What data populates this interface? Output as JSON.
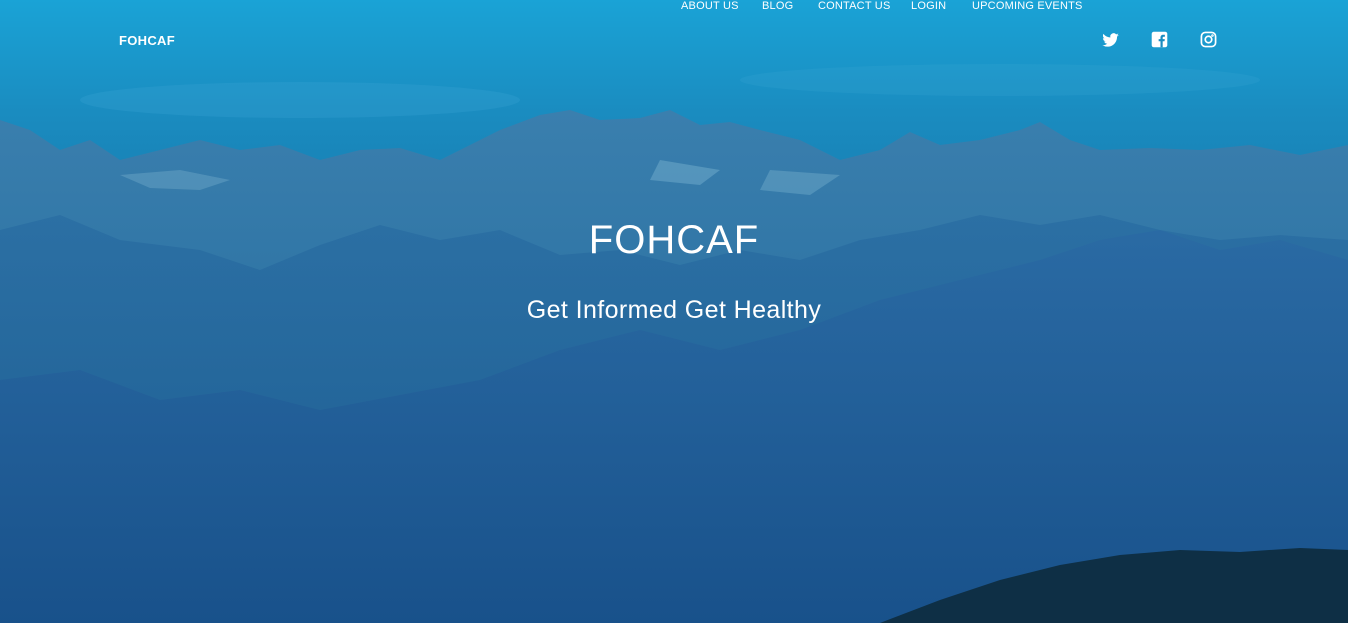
{
  "nav": {
    "brand": "FOHCAF",
    "links": [
      "ABOUT US",
      "BLOG",
      "CONTACT US",
      "LOGIN",
      "UPCOMING EVENTS"
    ],
    "social_icons": [
      "twitter-icon",
      "facebook-icon",
      "instagram-icon"
    ]
  },
  "hero": {
    "title": "FOHCAF",
    "subtitle": "Get Informed Get Healthy"
  },
  "colors": {
    "sky_top": "#1aa3d6",
    "sky_bottom": "#124f82",
    "text": "#ffffff"
  }
}
